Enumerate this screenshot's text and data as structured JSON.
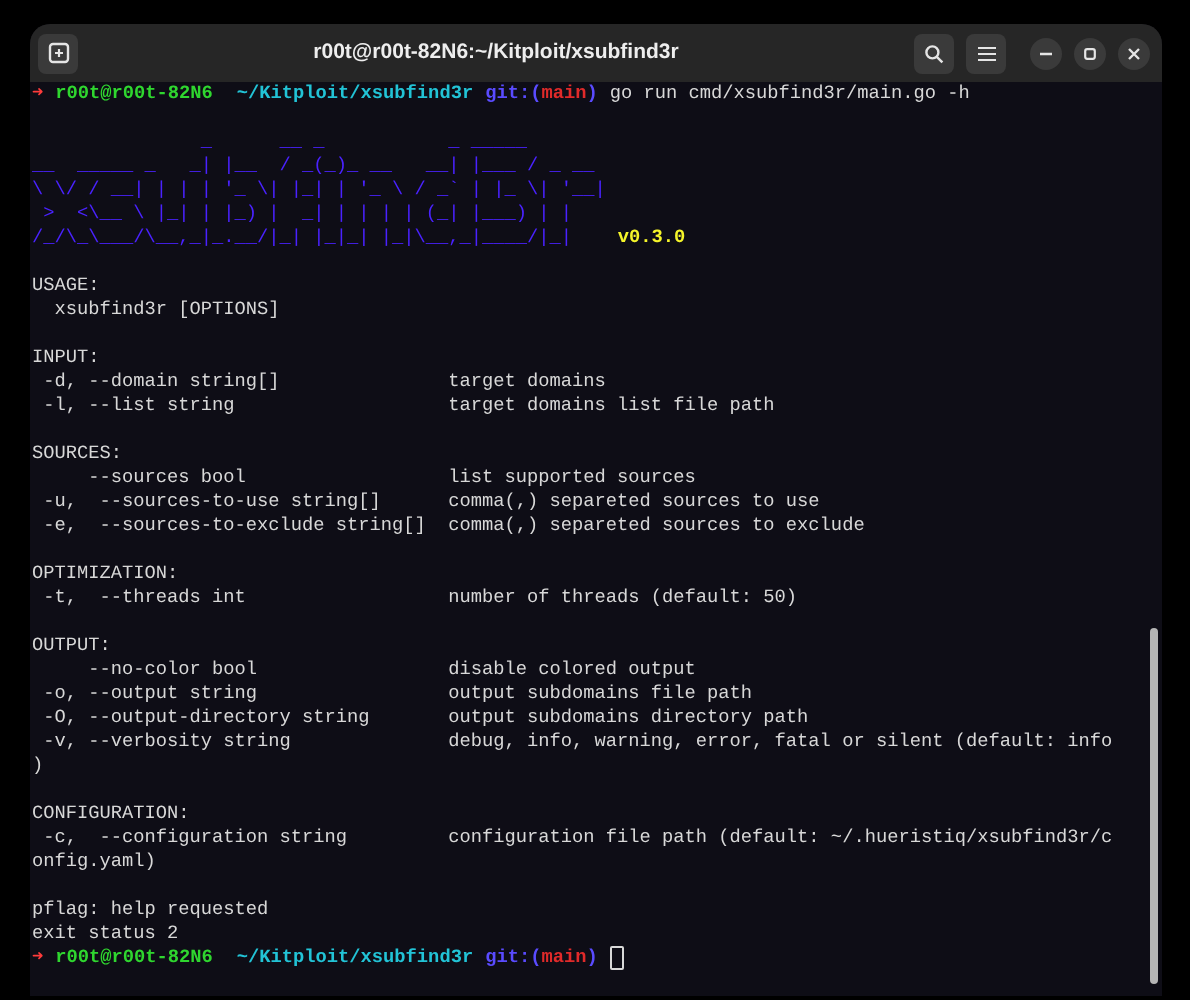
{
  "window": {
    "title": "r00t@r00t-82N6:~/Kitploit/xsubfind3r"
  },
  "blocks": [
    [
      {
        "kind": "prompt",
        "segments": [
          {
            "kind": "arrow",
            "text": "➜"
          },
          {
            "kind": "user",
            "text": "r00t@r00t-82N6"
          },
          {
            "kind": "path",
            "text": "~/Kitploit/xsubfind3r"
          },
          {
            "kind": "git",
            "text": "git:("
          },
          {
            "kind": "branch",
            "text": "main"
          },
          {
            "kind": "git",
            "text": ")"
          },
          {
            "kind": "command",
            "text": "go run cmd/xsubfind3r/main.go -h"
          }
        ]
      }
    ],
    [
      {
        "kind": "banner",
        "version": "v0.3.0",
        "art": "               _      __ _           _ _____\n__  _____ _   _| |__  / _(_)_ __   __| |___ / _ __\n\\ \\/ / __| | | | '_ \\| |_| | '_ \\ / _` | |_ \\| '__|\n >  <\\__ \\ |_| | |_) |  _| | | | | (_| |___) | |\n/_/\\_\\___/\\__,_|_.__/|_| |_|_| |_|\\__,_|____/|_|"
      }
    ],
    [
      {
        "kind": "text",
        "text": "USAGE:"
      },
      {
        "kind": "text",
        "text": "  xsubfind3r [OPTIONS]"
      }
    ],
    [
      {
        "kind": "text",
        "text": "INPUT:"
      },
      {
        "kind": "option",
        "option": " -d, --domain string[]",
        "description": "target domains"
      },
      {
        "kind": "option",
        "option": " -l, --list string",
        "description": "target domains list file path"
      }
    ],
    [
      {
        "kind": "text",
        "text": "SOURCES:"
      },
      {
        "kind": "option",
        "option": "     --sources bool",
        "description": "list supported sources"
      },
      {
        "kind": "option",
        "option": " -u,  --sources-to-use string[]",
        "description": "comma(,) separeted sources to use"
      },
      {
        "kind": "option",
        "option": " -e,  --sources-to-exclude string[]",
        "description": "comma(,) separeted sources to exclude"
      }
    ],
    [
      {
        "kind": "text",
        "text": "OPTIMIZATION:"
      },
      {
        "kind": "option",
        "option": " -t,  --threads int",
        "description": "number of threads (default: 50)"
      }
    ],
    [
      {
        "kind": "text",
        "text": "OUTPUT:"
      },
      {
        "kind": "option",
        "option": "     --no-color bool",
        "description": "disable colored output"
      },
      {
        "kind": "option",
        "option": " -o, --output string",
        "description": "output subdomains file path"
      },
      {
        "kind": "option",
        "option": " -O, --output-directory string",
        "description": "output subdomains directory path"
      },
      {
        "kind": "option",
        "option": " -v, --verbosity string",
        "description": "debug, info, warning, error, fatal or silent (default: info"
      },
      {
        "kind": "text",
        "text": ")"
      }
    ],
    [
      {
        "kind": "text",
        "text": "CONFIGURATION:"
      },
      {
        "kind": "option",
        "option": " -c,  --configuration string",
        "description": "configuration file path (default: ~/.hueristiq/xsubfind3r/c"
      },
      {
        "kind": "text",
        "text": "onfig.yaml)"
      }
    ],
    [
      {
        "kind": "text",
        "text": "pflag: help requested"
      },
      {
        "kind": "text",
        "text": "exit status 2"
      },
      {
        "kind": "prompt",
        "cursor": true,
        "segments": [
          {
            "kind": "arrow",
            "text": "➜"
          },
          {
            "kind": "user",
            "text": "r00t@r00t-82N6"
          },
          {
            "kind": "path",
            "text": "~/Kitploit/xsubfind3r"
          },
          {
            "kind": "git",
            "text": "git:("
          },
          {
            "kind": "branch",
            "text": "main"
          },
          {
            "kind": "git",
            "text": ")"
          }
        ]
      }
    ]
  ]
}
